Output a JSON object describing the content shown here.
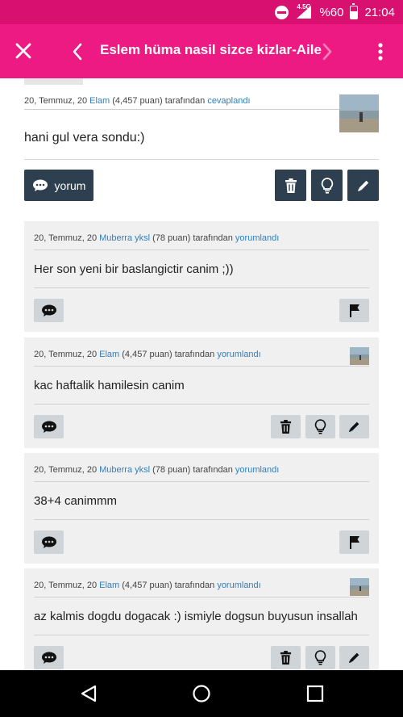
{
  "status": {
    "battery": "%60",
    "time": "21:04",
    "network": "4.5G"
  },
  "appbar": {
    "title": "Eslem hüma nasil sizce kizlar-Aile"
  },
  "answer": {
    "date": "20, Temmuz, 20",
    "user": "Elam",
    "points": "(4,457 puan)",
    "by": "tarafından",
    "action": "cevaplandı",
    "text": "hani gul vera sondu:)",
    "comment_label": "yorum"
  },
  "comments": [
    {
      "date": "20, Temmuz, 20",
      "user": "Muberra yksl",
      "points": "(78 puan)",
      "by": "tarafından",
      "action": "yorumlandı",
      "text": "Her son yeni bir baslangictir canim ;))",
      "own": false
    },
    {
      "date": "20, Temmuz, 20",
      "user": "Elam",
      "points": "(4,457 puan)",
      "by": "tarafından",
      "action": "yorumlandı",
      "text": "kac haftalik hamilesin canim",
      "own": true
    },
    {
      "date": "20, Temmuz, 20",
      "user": "Muberra yksl",
      "points": "(78 puan)",
      "by": "tarafından",
      "action": "yorumlandı",
      "text": "38+4 canimmm",
      "own": false
    },
    {
      "date": "20, Temmuz, 20",
      "user": "Elam",
      "points": "(4,457 puan)",
      "by": "tarafından",
      "action": "yorumlandı",
      "text": "az kalmis dogdu dogacak :) ismiyle dogsun buyusun insallah",
      "own": true
    }
  ],
  "colors": {
    "statusbar": "#d8106f",
    "appbar": "#ee1a83",
    "link": "#2f7fbf",
    "dark_button": "#2e3f4f"
  },
  "icons": [
    "close-icon",
    "back-arrow-icon",
    "forward-arrow-icon",
    "more-vert-icon",
    "speech-bubble-icon",
    "trash-icon",
    "lightbulb-icon",
    "pencil-icon",
    "flag-icon"
  ]
}
